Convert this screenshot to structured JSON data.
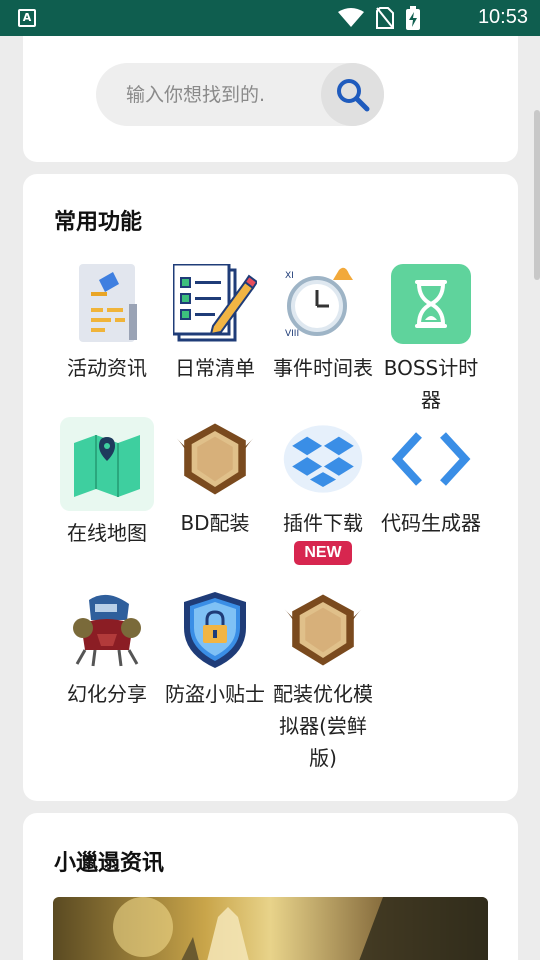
{
  "status_bar": {
    "app_indicator": "A",
    "time": "10:53",
    "icons": [
      "wifi-icon",
      "no-sim-icon",
      "battery-charging-icon"
    ]
  },
  "search": {
    "placeholder": "输入你想找到的.",
    "button_icon": "search-icon"
  },
  "functions": {
    "title": "常用功能",
    "items": [
      {
        "label": "活动资讯",
        "icon": "activity-news-icon"
      },
      {
        "label": "日常清单",
        "icon": "checklist-icon"
      },
      {
        "label": "事件时间表",
        "icon": "alarm-clock-icon"
      },
      {
        "label": "BOSS计时器",
        "icon": "hourglass-icon"
      },
      {
        "label": "在线地图",
        "icon": "map-icon"
      },
      {
        "label": "BD配装",
        "icon": "hex-emblem-icon"
      },
      {
        "label": "插件下载",
        "icon": "dropbox-icon",
        "badge": "NEW"
      },
      {
        "label": "代码生成器",
        "icon": "code-brackets-icon"
      },
      {
        "label": "幻化分享",
        "icon": "transmog-character-icon"
      },
      {
        "label": "防盗小贴士",
        "icon": "security-shield-icon"
      },
      {
        "label": "配装优化模拟器(尝鲜版)",
        "icon": "hex-emblem-icon"
      }
    ]
  },
  "news": {
    "title": "小邋遢资讯"
  },
  "colors": {
    "status_bar": "#0f5e4f",
    "search_icon": "#1f5bbd",
    "badge": "#d7264f",
    "hourglass_bg": "#5fd39c",
    "map_bg": "#3ecf9f",
    "code_blue": "#3a8ee6"
  }
}
